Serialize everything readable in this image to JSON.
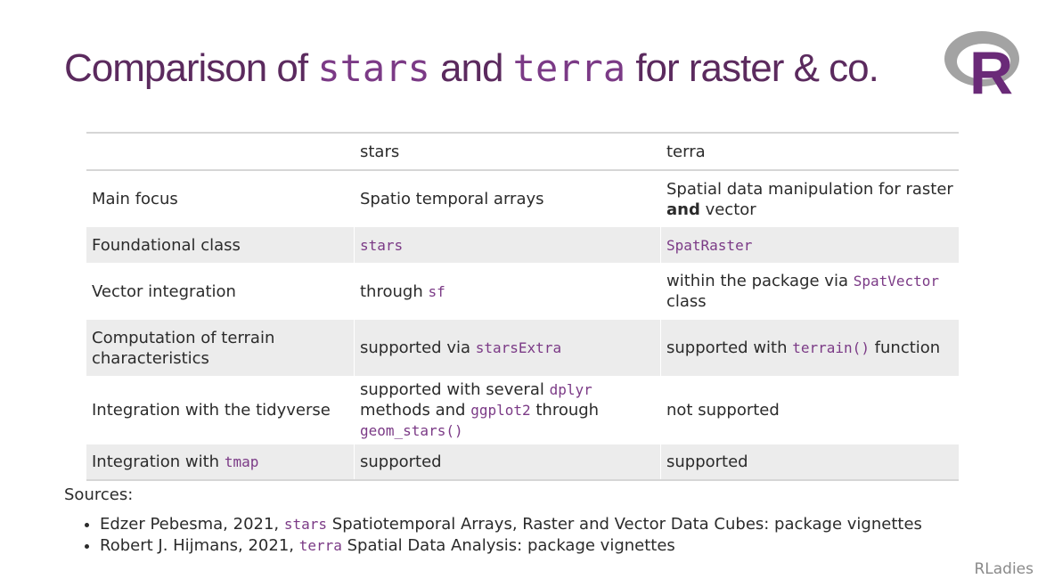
{
  "title": {
    "t1": "Comparison of ",
    "c1": "stars",
    "t2": " and ",
    "c2": "terra",
    "t3": " for raster & co."
  },
  "logo": {
    "icon": "r-logo-icon",
    "letter": "R",
    "ring_color": "#9a9a9a",
    "letter_color": "#6a2a78"
  },
  "table": {
    "headers": [
      "",
      "stars",
      "terra"
    ],
    "rows": {
      "main_focus": {
        "label": "Main focus",
        "stars": "Spatio temporal arrays",
        "terra_1": "Spatial data manipulation for raster ",
        "terra_bold": "and",
        "terra_2": " vector"
      },
      "foundational": {
        "label": "Foundational class",
        "stars_code": "stars",
        "terra_code": "SpatRaster"
      },
      "vector": {
        "label": "Vector integration",
        "stars_1": "through ",
        "stars_code": "sf",
        "terra_1": "within the package via ",
        "terra_code": "SpatVector",
        "terra_2": " class"
      },
      "terrain": {
        "label": "Computation of terrain characteristics",
        "stars_1": "supported via ",
        "stars_code": "starsExtra",
        "terra_1": "supported with ",
        "terra_code": "terrain()",
        "terra_2": " function"
      },
      "tidyverse": {
        "label": "Integration with the tidyverse",
        "stars_1": "supported with several ",
        "stars_code1": "dplyr",
        "stars_2": " methods and ",
        "stars_code2": "ggplot2",
        "stars_3": " through ",
        "stars_code3": "geom_stars()",
        "terra": "not supported"
      },
      "tmap": {
        "label_1": "Integration with ",
        "label_code": "tmap",
        "stars": "supported",
        "terra": "supported"
      }
    }
  },
  "sources": {
    "label": "Sources:",
    "items": [
      {
        "a": "Edzer Pebesma, 2021, ",
        "code": "stars",
        "b": " Spatiotemporal Arrays, Raster and Vector Data Cubes: package vignettes"
      },
      {
        "a": "Robert J. Hijmans, 2021, ",
        "code": "terra",
        "b": " Spatial Data Analysis: package vignettes"
      }
    ]
  },
  "footer": "RLadies"
}
